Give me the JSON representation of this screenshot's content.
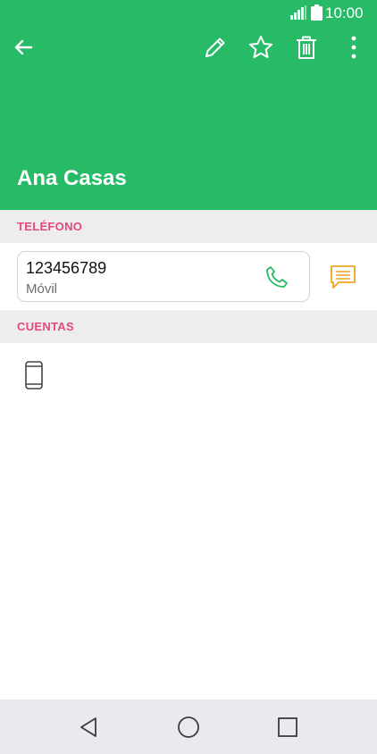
{
  "status_bar": {
    "time": "10:00"
  },
  "toolbar": {
    "back_icon": "arrow-left-icon",
    "edit_icon": "pencil-icon",
    "favorite_icon": "star-icon",
    "delete_icon": "trash-icon",
    "more_icon": "more-vertical-icon"
  },
  "contact": {
    "name": "Ana Casas"
  },
  "phone_section": {
    "title": "TELÉFONO",
    "number": "123456789",
    "type": "Móvil",
    "call_icon": "phone-icon",
    "message_icon": "message-icon"
  },
  "accounts_section": {
    "title": "CUENTAS",
    "device_icon": "smartphone-icon"
  },
  "nav": {
    "back_icon": "triangle-back-icon",
    "home_icon": "circle-home-icon",
    "recent_icon": "square-recent-icon"
  },
  "colors": {
    "header": "#27bb67",
    "section_title": "#e4497a",
    "call_icon": "#27bb67",
    "message_icon": "#f0a323",
    "section_bg": "#ededee",
    "nav_bg": "#e9eaee"
  }
}
